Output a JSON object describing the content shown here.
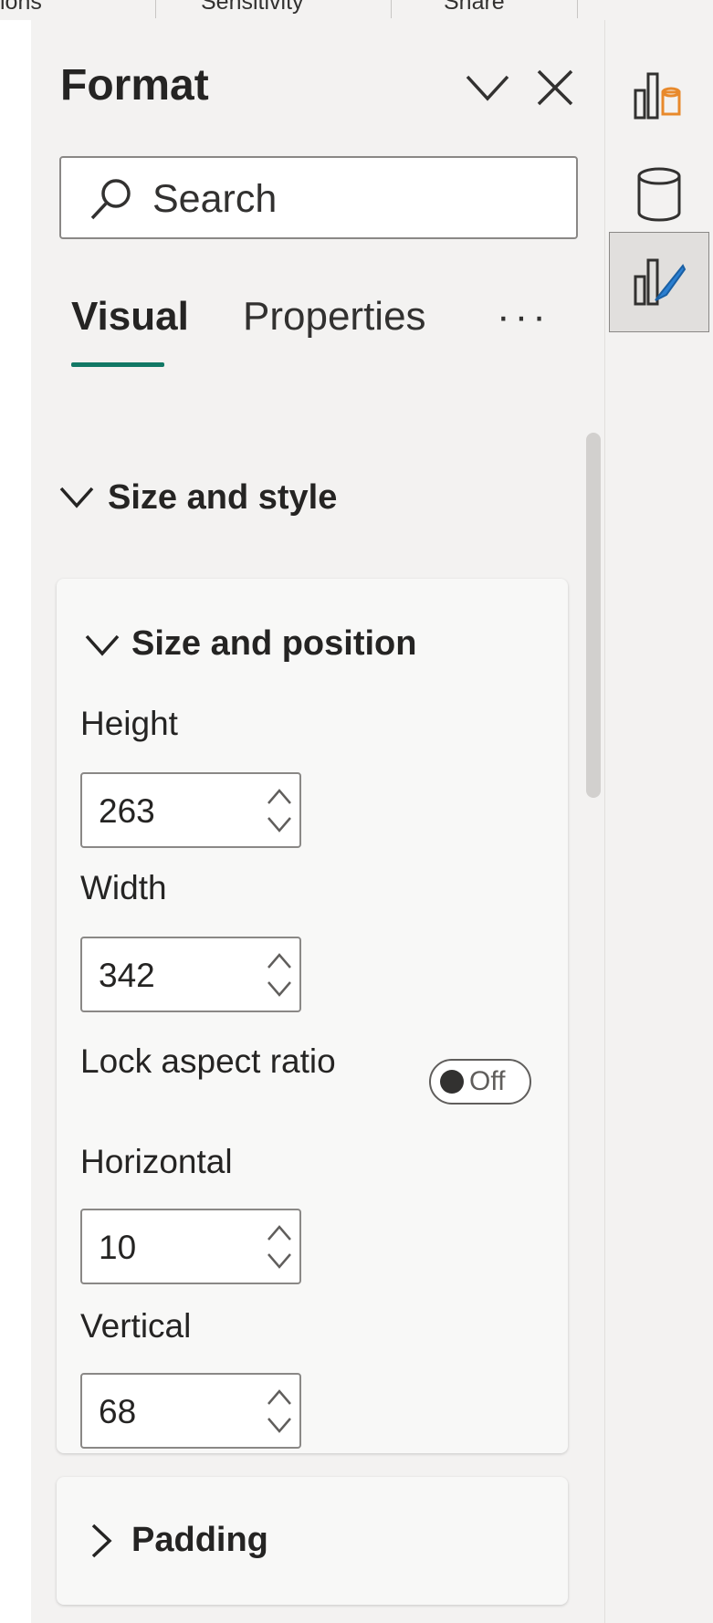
{
  "ribbon": {
    "items": [
      "ions",
      "Sensitivity",
      "Share"
    ]
  },
  "pane": {
    "title": "Format",
    "search_placeholder": "Search",
    "tabs": [
      {
        "label": "Visual",
        "active": true
      },
      {
        "label": "Properties",
        "active": false
      }
    ],
    "more_label": "···",
    "accent_color": "#117865"
  },
  "section": {
    "label": "Size and style",
    "expanded": true
  },
  "size_position": {
    "title": "Size and position",
    "height_label": "Height",
    "height_value": "263",
    "width_label": "Width",
    "width_value": "342",
    "lock_label": "Lock aspect ratio",
    "lock_state": "Off",
    "horizontal_label": "Horizontal",
    "horizontal_value": "10",
    "vertical_label": "Vertical",
    "vertical_value": "68"
  },
  "padding": {
    "title": "Padding",
    "expanded": false
  },
  "rail": {
    "icons": [
      "build-visual-icon",
      "data-icon",
      "format-visual-icon"
    ],
    "active": "format-visual-icon"
  }
}
